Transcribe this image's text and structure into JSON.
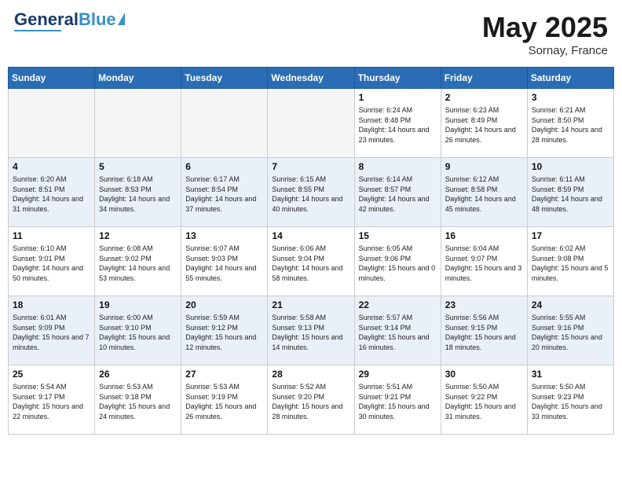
{
  "header": {
    "logo_general": "General",
    "logo_blue": "Blue",
    "month": "May 2025",
    "location": "Sornay, France"
  },
  "days_of_week": [
    "Sunday",
    "Monday",
    "Tuesday",
    "Wednesday",
    "Thursday",
    "Friday",
    "Saturday"
  ],
  "weeks": [
    [
      {
        "day": "",
        "sunrise": "",
        "sunset": "",
        "daylight": "",
        "empty": true
      },
      {
        "day": "",
        "sunrise": "",
        "sunset": "",
        "daylight": "",
        "empty": true
      },
      {
        "day": "",
        "sunrise": "",
        "sunset": "",
        "daylight": "",
        "empty": true
      },
      {
        "day": "",
        "sunrise": "",
        "sunset": "",
        "daylight": "",
        "empty": true
      },
      {
        "day": "1",
        "sunrise": "Sunrise: 6:24 AM",
        "sunset": "Sunset: 8:48 PM",
        "daylight": "Daylight: 14 hours and 23 minutes.",
        "empty": false
      },
      {
        "day": "2",
        "sunrise": "Sunrise: 6:23 AM",
        "sunset": "Sunset: 8:49 PM",
        "daylight": "Daylight: 14 hours and 26 minutes.",
        "empty": false
      },
      {
        "day": "3",
        "sunrise": "Sunrise: 6:21 AM",
        "sunset": "Sunset: 8:50 PM",
        "daylight": "Daylight: 14 hours and 28 minutes.",
        "empty": false
      }
    ],
    [
      {
        "day": "4",
        "sunrise": "Sunrise: 6:20 AM",
        "sunset": "Sunset: 8:51 PM",
        "daylight": "Daylight: 14 hours and 31 minutes.",
        "empty": false
      },
      {
        "day": "5",
        "sunrise": "Sunrise: 6:18 AM",
        "sunset": "Sunset: 8:53 PM",
        "daylight": "Daylight: 14 hours and 34 minutes.",
        "empty": false
      },
      {
        "day": "6",
        "sunrise": "Sunrise: 6:17 AM",
        "sunset": "Sunset: 8:54 PM",
        "daylight": "Daylight: 14 hours and 37 minutes.",
        "empty": false
      },
      {
        "day": "7",
        "sunrise": "Sunrise: 6:15 AM",
        "sunset": "Sunset: 8:55 PM",
        "daylight": "Daylight: 14 hours and 40 minutes.",
        "empty": false
      },
      {
        "day": "8",
        "sunrise": "Sunrise: 6:14 AM",
        "sunset": "Sunset: 8:57 PM",
        "daylight": "Daylight: 14 hours and 42 minutes.",
        "empty": false
      },
      {
        "day": "9",
        "sunrise": "Sunrise: 6:12 AM",
        "sunset": "Sunset: 8:58 PM",
        "daylight": "Daylight: 14 hours and 45 minutes.",
        "empty": false
      },
      {
        "day": "10",
        "sunrise": "Sunrise: 6:11 AM",
        "sunset": "Sunset: 8:59 PM",
        "daylight": "Daylight: 14 hours and 48 minutes.",
        "empty": false
      }
    ],
    [
      {
        "day": "11",
        "sunrise": "Sunrise: 6:10 AM",
        "sunset": "Sunset: 9:01 PM",
        "daylight": "Daylight: 14 hours and 50 minutes.",
        "empty": false
      },
      {
        "day": "12",
        "sunrise": "Sunrise: 6:08 AM",
        "sunset": "Sunset: 9:02 PM",
        "daylight": "Daylight: 14 hours and 53 minutes.",
        "empty": false
      },
      {
        "day": "13",
        "sunrise": "Sunrise: 6:07 AM",
        "sunset": "Sunset: 9:03 PM",
        "daylight": "Daylight: 14 hours and 55 minutes.",
        "empty": false
      },
      {
        "day": "14",
        "sunrise": "Sunrise: 6:06 AM",
        "sunset": "Sunset: 9:04 PM",
        "daylight": "Daylight: 14 hours and 58 minutes.",
        "empty": false
      },
      {
        "day": "15",
        "sunrise": "Sunrise: 6:05 AM",
        "sunset": "Sunset: 9:06 PM",
        "daylight": "Daylight: 15 hours and 0 minutes.",
        "empty": false
      },
      {
        "day": "16",
        "sunrise": "Sunrise: 6:04 AM",
        "sunset": "Sunset: 9:07 PM",
        "daylight": "Daylight: 15 hours and 3 minutes.",
        "empty": false
      },
      {
        "day": "17",
        "sunrise": "Sunrise: 6:02 AM",
        "sunset": "Sunset: 9:08 PM",
        "daylight": "Daylight: 15 hours and 5 minutes.",
        "empty": false
      }
    ],
    [
      {
        "day": "18",
        "sunrise": "Sunrise: 6:01 AM",
        "sunset": "Sunset: 9:09 PM",
        "daylight": "Daylight: 15 hours and 7 minutes.",
        "empty": false
      },
      {
        "day": "19",
        "sunrise": "Sunrise: 6:00 AM",
        "sunset": "Sunset: 9:10 PM",
        "daylight": "Daylight: 15 hours and 10 minutes.",
        "empty": false
      },
      {
        "day": "20",
        "sunrise": "Sunrise: 5:59 AM",
        "sunset": "Sunset: 9:12 PM",
        "daylight": "Daylight: 15 hours and 12 minutes.",
        "empty": false
      },
      {
        "day": "21",
        "sunrise": "Sunrise: 5:58 AM",
        "sunset": "Sunset: 9:13 PM",
        "daylight": "Daylight: 15 hours and 14 minutes.",
        "empty": false
      },
      {
        "day": "22",
        "sunrise": "Sunrise: 5:57 AM",
        "sunset": "Sunset: 9:14 PM",
        "daylight": "Daylight: 15 hours and 16 minutes.",
        "empty": false
      },
      {
        "day": "23",
        "sunrise": "Sunrise: 5:56 AM",
        "sunset": "Sunset: 9:15 PM",
        "daylight": "Daylight: 15 hours and 18 minutes.",
        "empty": false
      },
      {
        "day": "24",
        "sunrise": "Sunrise: 5:55 AM",
        "sunset": "Sunset: 9:16 PM",
        "daylight": "Daylight: 15 hours and 20 minutes.",
        "empty": false
      }
    ],
    [
      {
        "day": "25",
        "sunrise": "Sunrise: 5:54 AM",
        "sunset": "Sunset: 9:17 PM",
        "daylight": "Daylight: 15 hours and 22 minutes.",
        "empty": false
      },
      {
        "day": "26",
        "sunrise": "Sunrise: 5:53 AM",
        "sunset": "Sunset: 9:18 PM",
        "daylight": "Daylight: 15 hours and 24 minutes.",
        "empty": false
      },
      {
        "day": "27",
        "sunrise": "Sunrise: 5:53 AM",
        "sunset": "Sunset: 9:19 PM",
        "daylight": "Daylight: 15 hours and 26 minutes.",
        "empty": false
      },
      {
        "day": "28",
        "sunrise": "Sunrise: 5:52 AM",
        "sunset": "Sunset: 9:20 PM",
        "daylight": "Daylight: 15 hours and 28 minutes.",
        "empty": false
      },
      {
        "day": "29",
        "sunrise": "Sunrise: 5:51 AM",
        "sunset": "Sunset: 9:21 PM",
        "daylight": "Daylight: 15 hours and 30 minutes.",
        "empty": false
      },
      {
        "day": "30",
        "sunrise": "Sunrise: 5:50 AM",
        "sunset": "Sunset: 9:22 PM",
        "daylight": "Daylight: 15 hours and 31 minutes.",
        "empty": false
      },
      {
        "day": "31",
        "sunrise": "Sunrise: 5:50 AM",
        "sunset": "Sunset: 9:23 PM",
        "daylight": "Daylight: 15 hours and 33 minutes.",
        "empty": false
      }
    ]
  ]
}
